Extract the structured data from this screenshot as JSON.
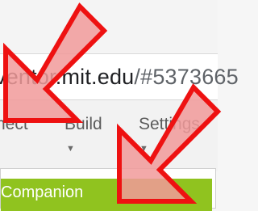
{
  "address_bar": {
    "host": "ventor.mit.edu",
    "path": "/#5373665"
  },
  "menu": {
    "items": [
      {
        "label": "nect"
      },
      {
        "label": "Build"
      },
      {
        "label": "Settings"
      }
    ],
    "caret": "▼"
  },
  "dropdown": {
    "highlighted_item": "Companion"
  },
  "annotations": {
    "arrow_count": 2,
    "fill_color": "#f19a9a",
    "stroke_color": "#ee1111"
  },
  "colors": {
    "menu_highlight": "#90c31f"
  }
}
